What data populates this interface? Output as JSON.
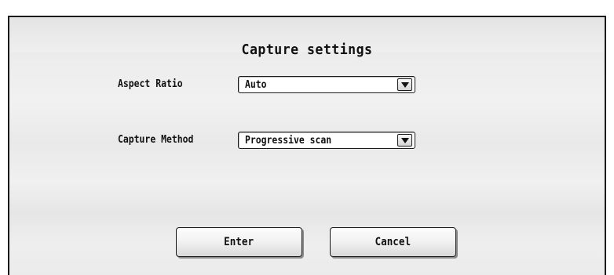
{
  "dialog": {
    "title": "Capture settings",
    "aspect_ratio": {
      "label": "Aspect Ratio",
      "value": "Auto"
    },
    "capture_method": {
      "label": "Capture Method",
      "value": "Progressive scan"
    },
    "buttons": {
      "enter": "Enter",
      "cancel": "Cancel"
    }
  }
}
